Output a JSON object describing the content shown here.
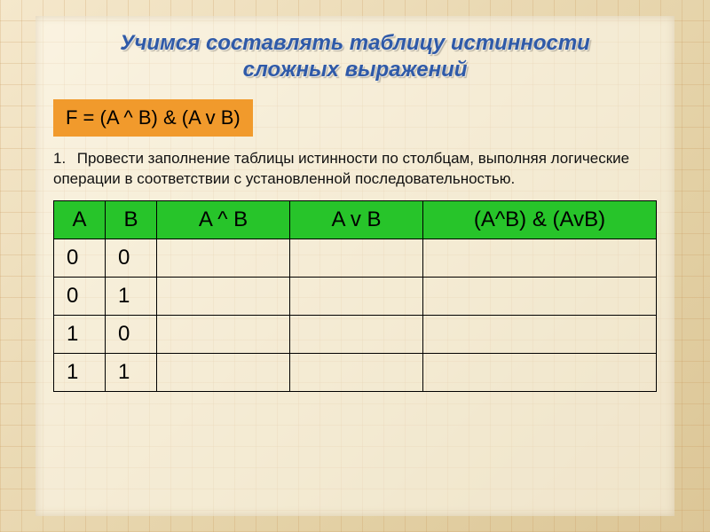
{
  "title_line1": "Учимся составлять таблицу истинности",
  "title_line2": "сложных выражений",
  "formula": "F = (A ^ B) & (A v B)",
  "instruction_number": "1.",
  "instruction_text": "Провести заполнение таблицы истинности по столбцам, выполняя логические операции в соответствии с установленной последовательностью.",
  "table": {
    "headers": [
      "A",
      "B",
      "A ^ B",
      "A v B",
      "(A^B) & (AvB)"
    ],
    "rows": [
      [
        "0",
        "0",
        "",
        "",
        ""
      ],
      [
        "0",
        "1",
        "",
        "",
        ""
      ],
      [
        "1",
        "0",
        "",
        "",
        ""
      ],
      [
        "1",
        "1",
        "",
        "",
        ""
      ]
    ]
  }
}
